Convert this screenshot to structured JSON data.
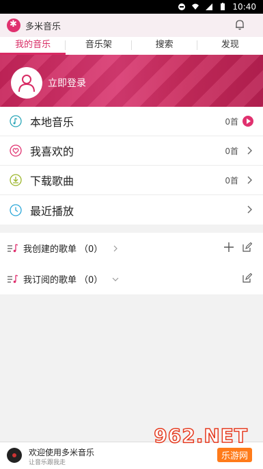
{
  "statusbar": {
    "time": "10:40"
  },
  "app": {
    "title": "多米音乐"
  },
  "tabs": [
    {
      "label": "我的音乐",
      "active": true
    },
    {
      "label": "音乐架",
      "active": false
    },
    {
      "label": "搜索",
      "active": false
    },
    {
      "label": "发现",
      "active": false
    }
  ],
  "hero": {
    "login_label": "立即登录"
  },
  "library": [
    {
      "icon": "music-note-icon",
      "label": "本地音乐",
      "count": "0首",
      "action": "play"
    },
    {
      "icon": "heart-icon",
      "label": "我喜欢的",
      "count": "0首",
      "action": "chevron"
    },
    {
      "icon": "download-icon",
      "label": "下载歌曲",
      "count": "0首",
      "action": "chevron"
    },
    {
      "icon": "clock-icon",
      "label": "最近播放",
      "count": "",
      "action": "chevron"
    }
  ],
  "playlists": [
    {
      "label": "我创建的歌单",
      "count": "（0）",
      "chevron": "right",
      "add": true
    },
    {
      "label": "我订阅的歌单",
      "count": "（0）",
      "chevron": "down",
      "add": false
    }
  ],
  "player": {
    "title": "欢迎使用多米音乐",
    "subtitle": "让音乐跟我走"
  },
  "watermark": {
    "number": "962.NET",
    "text": "乐游网"
  },
  "colors": {
    "accent": "#d82a63",
    "hero": "#c7245a"
  }
}
